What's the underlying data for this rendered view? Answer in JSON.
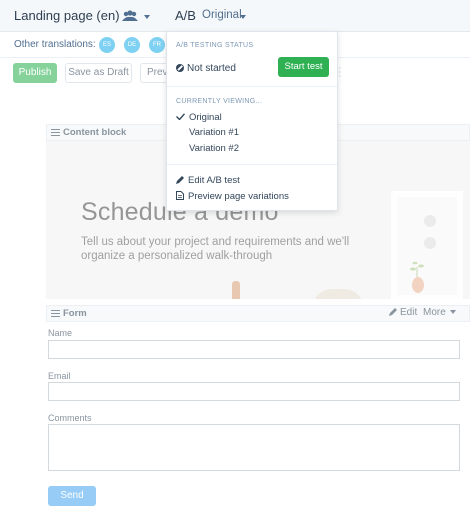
{
  "header": {
    "page_title": "Landing page (en)",
    "ab_label": "A/B",
    "ab_current": "Original",
    "team_icon": "users-icon"
  },
  "translations": {
    "label": "Other translations:",
    "chips": [
      "ES",
      "DE",
      "FR"
    ]
  },
  "actions": {
    "publish": "Publish",
    "save_draft": "Save as Draft",
    "preview": "Preview"
  },
  "dropdown": {
    "status_heading": "A/B TESTING STATUS",
    "status_value": "Not started",
    "start_test": "Start test",
    "viewing_heading": "CURRENTLY VIEWING...",
    "options": [
      "Original",
      "Variation #1",
      "Variation #2"
    ],
    "selected": "Original",
    "edit_test": "Edit A/B test",
    "preview_variations": "Preview page variations"
  },
  "content_block": {
    "bar_title": "Content block",
    "hero_title": "Schedule a demo",
    "hero_subtitle": "Tell us about your project and requirements and we'll organize a personalized walk-through"
  },
  "form": {
    "bar_title": "Form",
    "edit": "Edit",
    "more": "More",
    "fields": [
      {
        "label": "Name",
        "value": ""
      },
      {
        "label": "Email",
        "value": ""
      },
      {
        "label": "Comments",
        "value": ""
      }
    ],
    "submit": "Send"
  },
  "colors": {
    "primary_green": "#2fb153",
    "chip_blue": "#7fd1f3",
    "send_blue": "#4aa8f0",
    "text_dark": "#33475b"
  }
}
